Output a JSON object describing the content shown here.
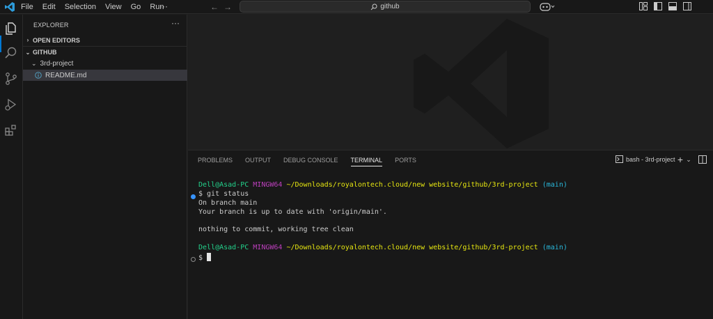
{
  "titlebar": {
    "menu": [
      "File",
      "Edit",
      "Selection",
      "View",
      "Go",
      "Run"
    ],
    "more": "···",
    "search_label": "github",
    "colors": {
      "accent": "#0078d4"
    }
  },
  "sidebar": {
    "header": "EXPLORER",
    "dots": "···",
    "open_editors": "OPEN EDITORS",
    "workspace": "GITHUB",
    "folder": "3rd-project",
    "file": "README.md"
  },
  "panel": {
    "tabs": [
      "PROBLEMS",
      "OUTPUT",
      "DEBUG CONSOLE",
      "TERMINAL",
      "PORTS"
    ],
    "active_tab": "TERMINAL",
    "terminal_name": "bash - 3rd-project"
  },
  "terminal": {
    "prompt_user": "Dell@Asad-PC",
    "prompt_env": "MINGW64",
    "prompt_path": "~/Downloads/royalontech.cloud/new website/github/3rd-project",
    "prompt_branch": "(main)",
    "command": "$ git status",
    "output_1": "On branch main",
    "output_2": "Your branch is up to date with 'origin/main'.",
    "output_3": "nothing to commit, working tree clean",
    "prompt_symbol": "$"
  }
}
